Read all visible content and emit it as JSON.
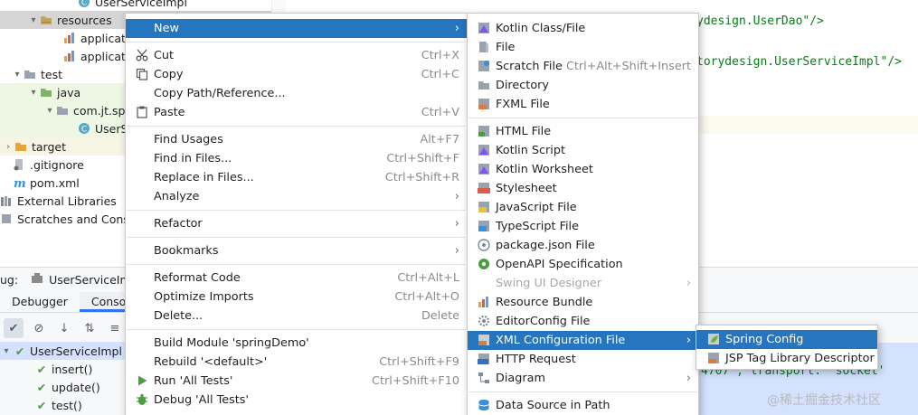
{
  "project_tree": {
    "rows": [
      {
        "label": "UserServiceImpl",
        "indent": "level5"
      },
      {
        "label": "resources",
        "indent": "level2"
      },
      {
        "label": "applicatio",
        "indent": "level3"
      },
      {
        "label": "applicatio",
        "indent": "level3"
      },
      {
        "label": "test",
        "indent": "level1"
      },
      {
        "label": "java",
        "indent": "level2"
      },
      {
        "label": "com.jt.sp",
        "indent": "level3"
      },
      {
        "label": "UserS",
        "indent": "level4"
      },
      {
        "label": "target",
        "indent": "level0"
      },
      {
        "label": ".gitignore",
        "indent": "level0"
      },
      {
        "label": "pom.xml",
        "indent": "level0"
      },
      {
        "label": "External Libraries",
        "indent": "level0"
      },
      {
        "label": "Scratches and Conso",
        "indent": "level0"
      }
    ]
  },
  "editor": {
    "lines": [
      {
        "text": "ydesign.UserDao\"/>"
      },
      {
        "text": "torydesign.UserServiceImpl\"/>"
      }
    ]
  },
  "debug": {
    "prefix": "ug:",
    "run_config": "UserServiceIm",
    "tabs": [
      "Debugger",
      "Console"
    ],
    "test_root": "UserServiceImpl",
    "tests": [
      "insert()",
      "update()",
      "test()"
    ],
    "console_text": "4707', transport: 'socket'",
    "watermark": "@稀土掘金技术社区"
  },
  "menu": {
    "items": [
      {
        "label": "New",
        "shortcut": "",
        "submenu": true,
        "active": true
      },
      {
        "label": "Cut",
        "shortcut": "Ctrl+X",
        "icon": "cut-icon"
      },
      {
        "label": "Copy",
        "shortcut": "Ctrl+C",
        "icon": "copy-icon"
      },
      {
        "label": "Copy Path/Reference...",
        "shortcut": ""
      },
      {
        "label": "Paste",
        "shortcut": "Ctrl+V",
        "icon": "paste-icon"
      },
      {
        "label": "Find Usages",
        "shortcut": "Alt+F7"
      },
      {
        "label": "Find in Files...",
        "shortcut": "Ctrl+Shift+F"
      },
      {
        "label": "Replace in Files...",
        "shortcut": "Ctrl+Shift+R"
      },
      {
        "label": "Analyze",
        "shortcut": "",
        "submenu": true
      },
      {
        "label": "Refactor",
        "shortcut": "",
        "submenu": true
      },
      {
        "label": "Bookmarks",
        "shortcut": "",
        "submenu": true
      },
      {
        "label": "Reformat Code",
        "shortcut": "Ctrl+Alt+L"
      },
      {
        "label": "Optimize Imports",
        "shortcut": "Ctrl+Alt+O"
      },
      {
        "label": "Delete...",
        "shortcut": "Delete"
      },
      {
        "label": "Build Module 'springDemo'",
        "shortcut": ""
      },
      {
        "label": "Rebuild '<default>'",
        "shortcut": "Ctrl+Shift+F9"
      },
      {
        "label": "Run 'All Tests'",
        "shortcut": "Ctrl+Shift+F10",
        "icon": "run-icon"
      },
      {
        "label": "Debug 'All Tests'",
        "shortcut": "",
        "icon": "debug-icon"
      }
    ]
  },
  "new_submenu": {
    "items": [
      {
        "label": "Kotlin Class/File",
        "shortcut": "",
        "icon": "kotlin-class-icon"
      },
      {
        "label": "File",
        "shortcut": "",
        "icon": "file-icon"
      },
      {
        "label": "Scratch File",
        "shortcut": "Ctrl+Alt+Shift+Insert",
        "icon": "scratch-file-icon"
      },
      {
        "label": "Directory",
        "shortcut": "",
        "icon": "directory-icon"
      },
      {
        "label": "FXML File",
        "shortcut": "",
        "icon": "fxml-file-icon"
      },
      {
        "label": "HTML File",
        "shortcut": "",
        "icon": "html-file-icon"
      },
      {
        "label": "Kotlin Script",
        "shortcut": "",
        "icon": "kotlin-script-icon"
      },
      {
        "label": "Kotlin Worksheet",
        "shortcut": "",
        "icon": "kotlin-worksheet-icon"
      },
      {
        "label": "Stylesheet",
        "shortcut": "",
        "icon": "stylesheet-icon"
      },
      {
        "label": "JavaScript File",
        "shortcut": "",
        "icon": "javascript-file-icon"
      },
      {
        "label": "TypeScript File",
        "shortcut": "",
        "icon": "typescript-file-icon"
      },
      {
        "label": "package.json File",
        "shortcut": "",
        "icon": "package-json-icon"
      },
      {
        "label": "OpenAPI Specification",
        "shortcut": "",
        "icon": "openapi-icon"
      },
      {
        "label": "Swing UI Designer",
        "shortcut": "",
        "submenu": true,
        "disabled": true
      },
      {
        "label": "Resource Bundle",
        "shortcut": "",
        "icon": "resource-bundle-icon"
      },
      {
        "label": "EditorConfig File",
        "shortcut": "",
        "icon": "editorconfig-icon"
      },
      {
        "label": "XML Configuration File",
        "shortcut": "",
        "submenu": true,
        "active": true,
        "icon": "xml-config-icon"
      },
      {
        "label": "HTTP Request",
        "shortcut": "",
        "icon": "http-request-icon"
      },
      {
        "label": "Diagram",
        "shortcut": "",
        "submenu": true,
        "icon": "diagram-icon"
      },
      {
        "label": "Data Source in Path",
        "shortcut": "",
        "icon": "data-source-icon"
      }
    ]
  },
  "xml_submenu": {
    "items": [
      {
        "label": "Spring Config",
        "active": true,
        "icon": "spring-config-icon"
      },
      {
        "label": "JSP Tag Library Descriptor",
        "icon": "jsp-tag-icon"
      }
    ]
  },
  "colors": {
    "menu_highlight": "#2675bf",
    "string_green": "#067d17",
    "folder_orange": "#e8a33d",
    "check_green": "#4a9e3f"
  }
}
